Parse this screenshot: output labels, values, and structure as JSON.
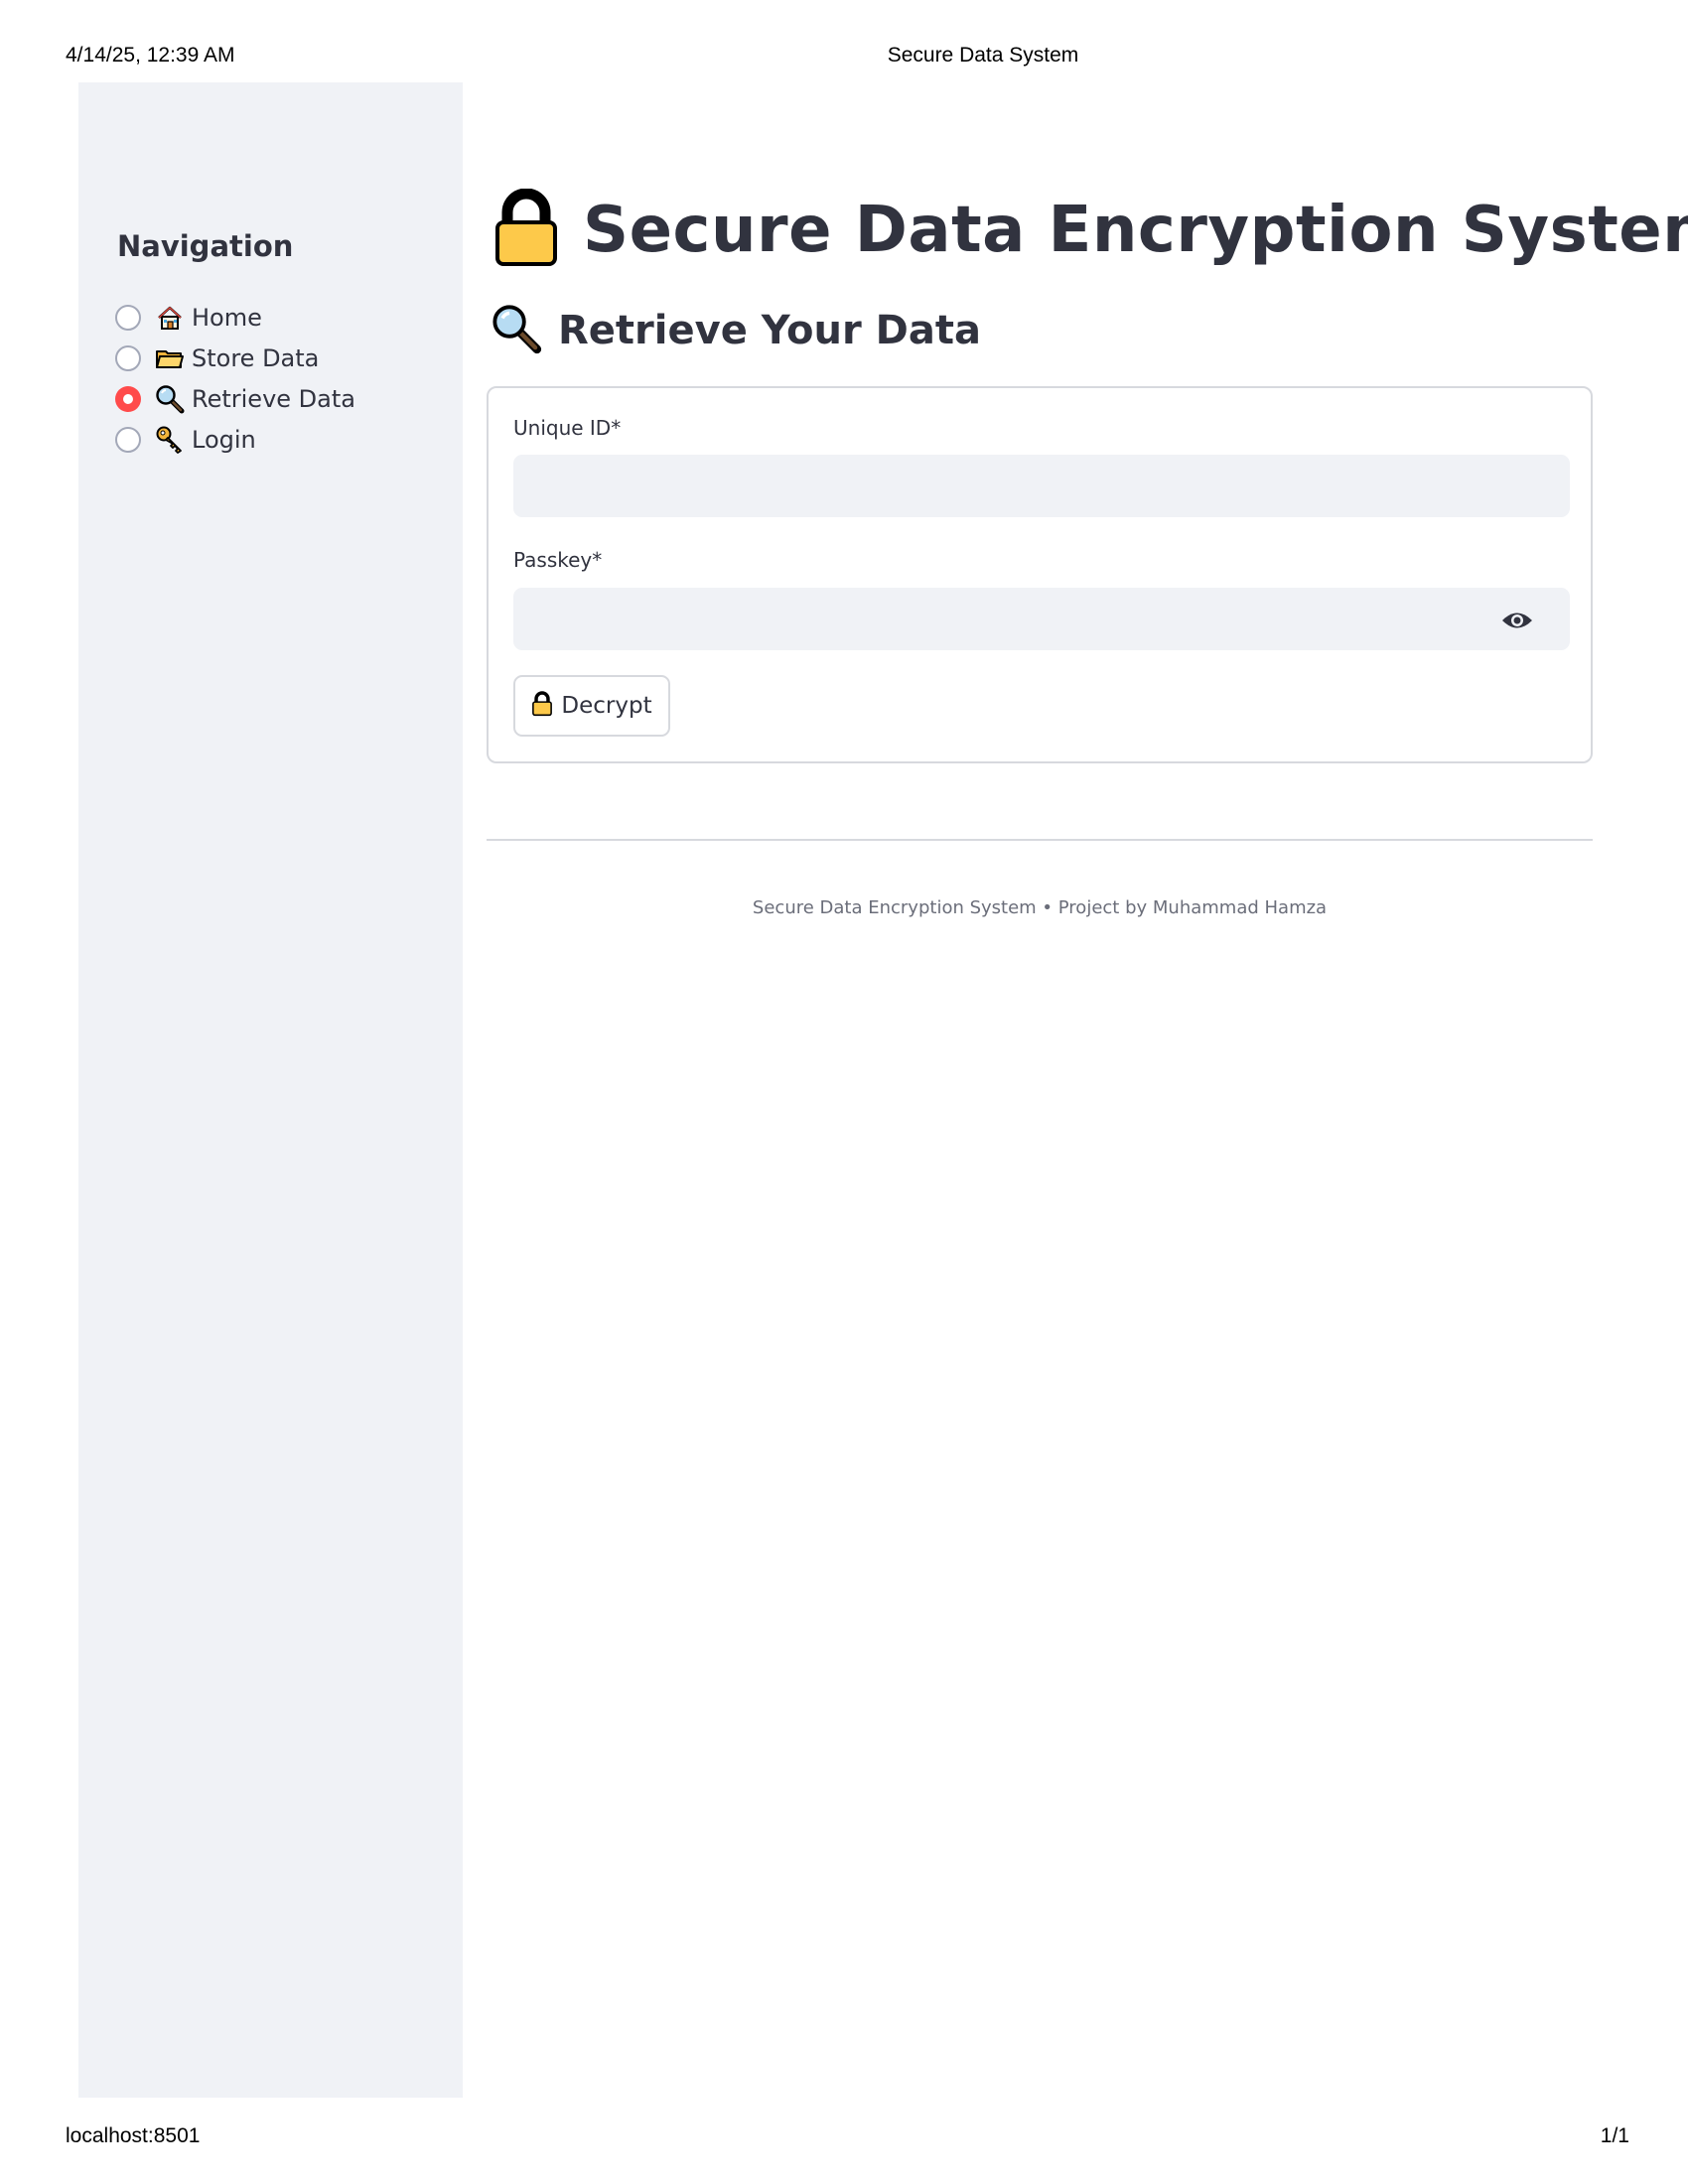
{
  "print": {
    "datetime": "4/14/25, 12:39 AM",
    "page_title": "Secure Data System",
    "url": "localhost:8501",
    "page_number": "1/1"
  },
  "sidebar": {
    "title": "Navigation",
    "items": [
      {
        "icon": "house-icon",
        "label": "Home",
        "selected": false
      },
      {
        "icon": "folder-icon",
        "label": "Store Data",
        "selected": false
      },
      {
        "icon": "magnifier-icon",
        "label": "Retrieve Data",
        "selected": true
      },
      {
        "icon": "key-icon",
        "label": "Login",
        "selected": false
      }
    ]
  },
  "main": {
    "title": "Secure Data Encryption System",
    "title_icon": "lock-icon",
    "subtitle": "Retrieve Your Data",
    "subtitle_icon": "magnifier-icon",
    "form": {
      "unique_id_label": "Unique ID*",
      "unique_id_value": "",
      "passkey_label": "Passkey*",
      "passkey_value": "",
      "decrypt_label": "Decrypt",
      "decrypt_icon": "lock-icon"
    },
    "footer": "Secure Data Encryption System • Project by Muhammad Hamza"
  },
  "colors": {
    "accent": "#ff4b4b",
    "sidebar_bg": "#f0f2f6",
    "text": "#31333f",
    "lock_yellow": "#fdc94a"
  }
}
